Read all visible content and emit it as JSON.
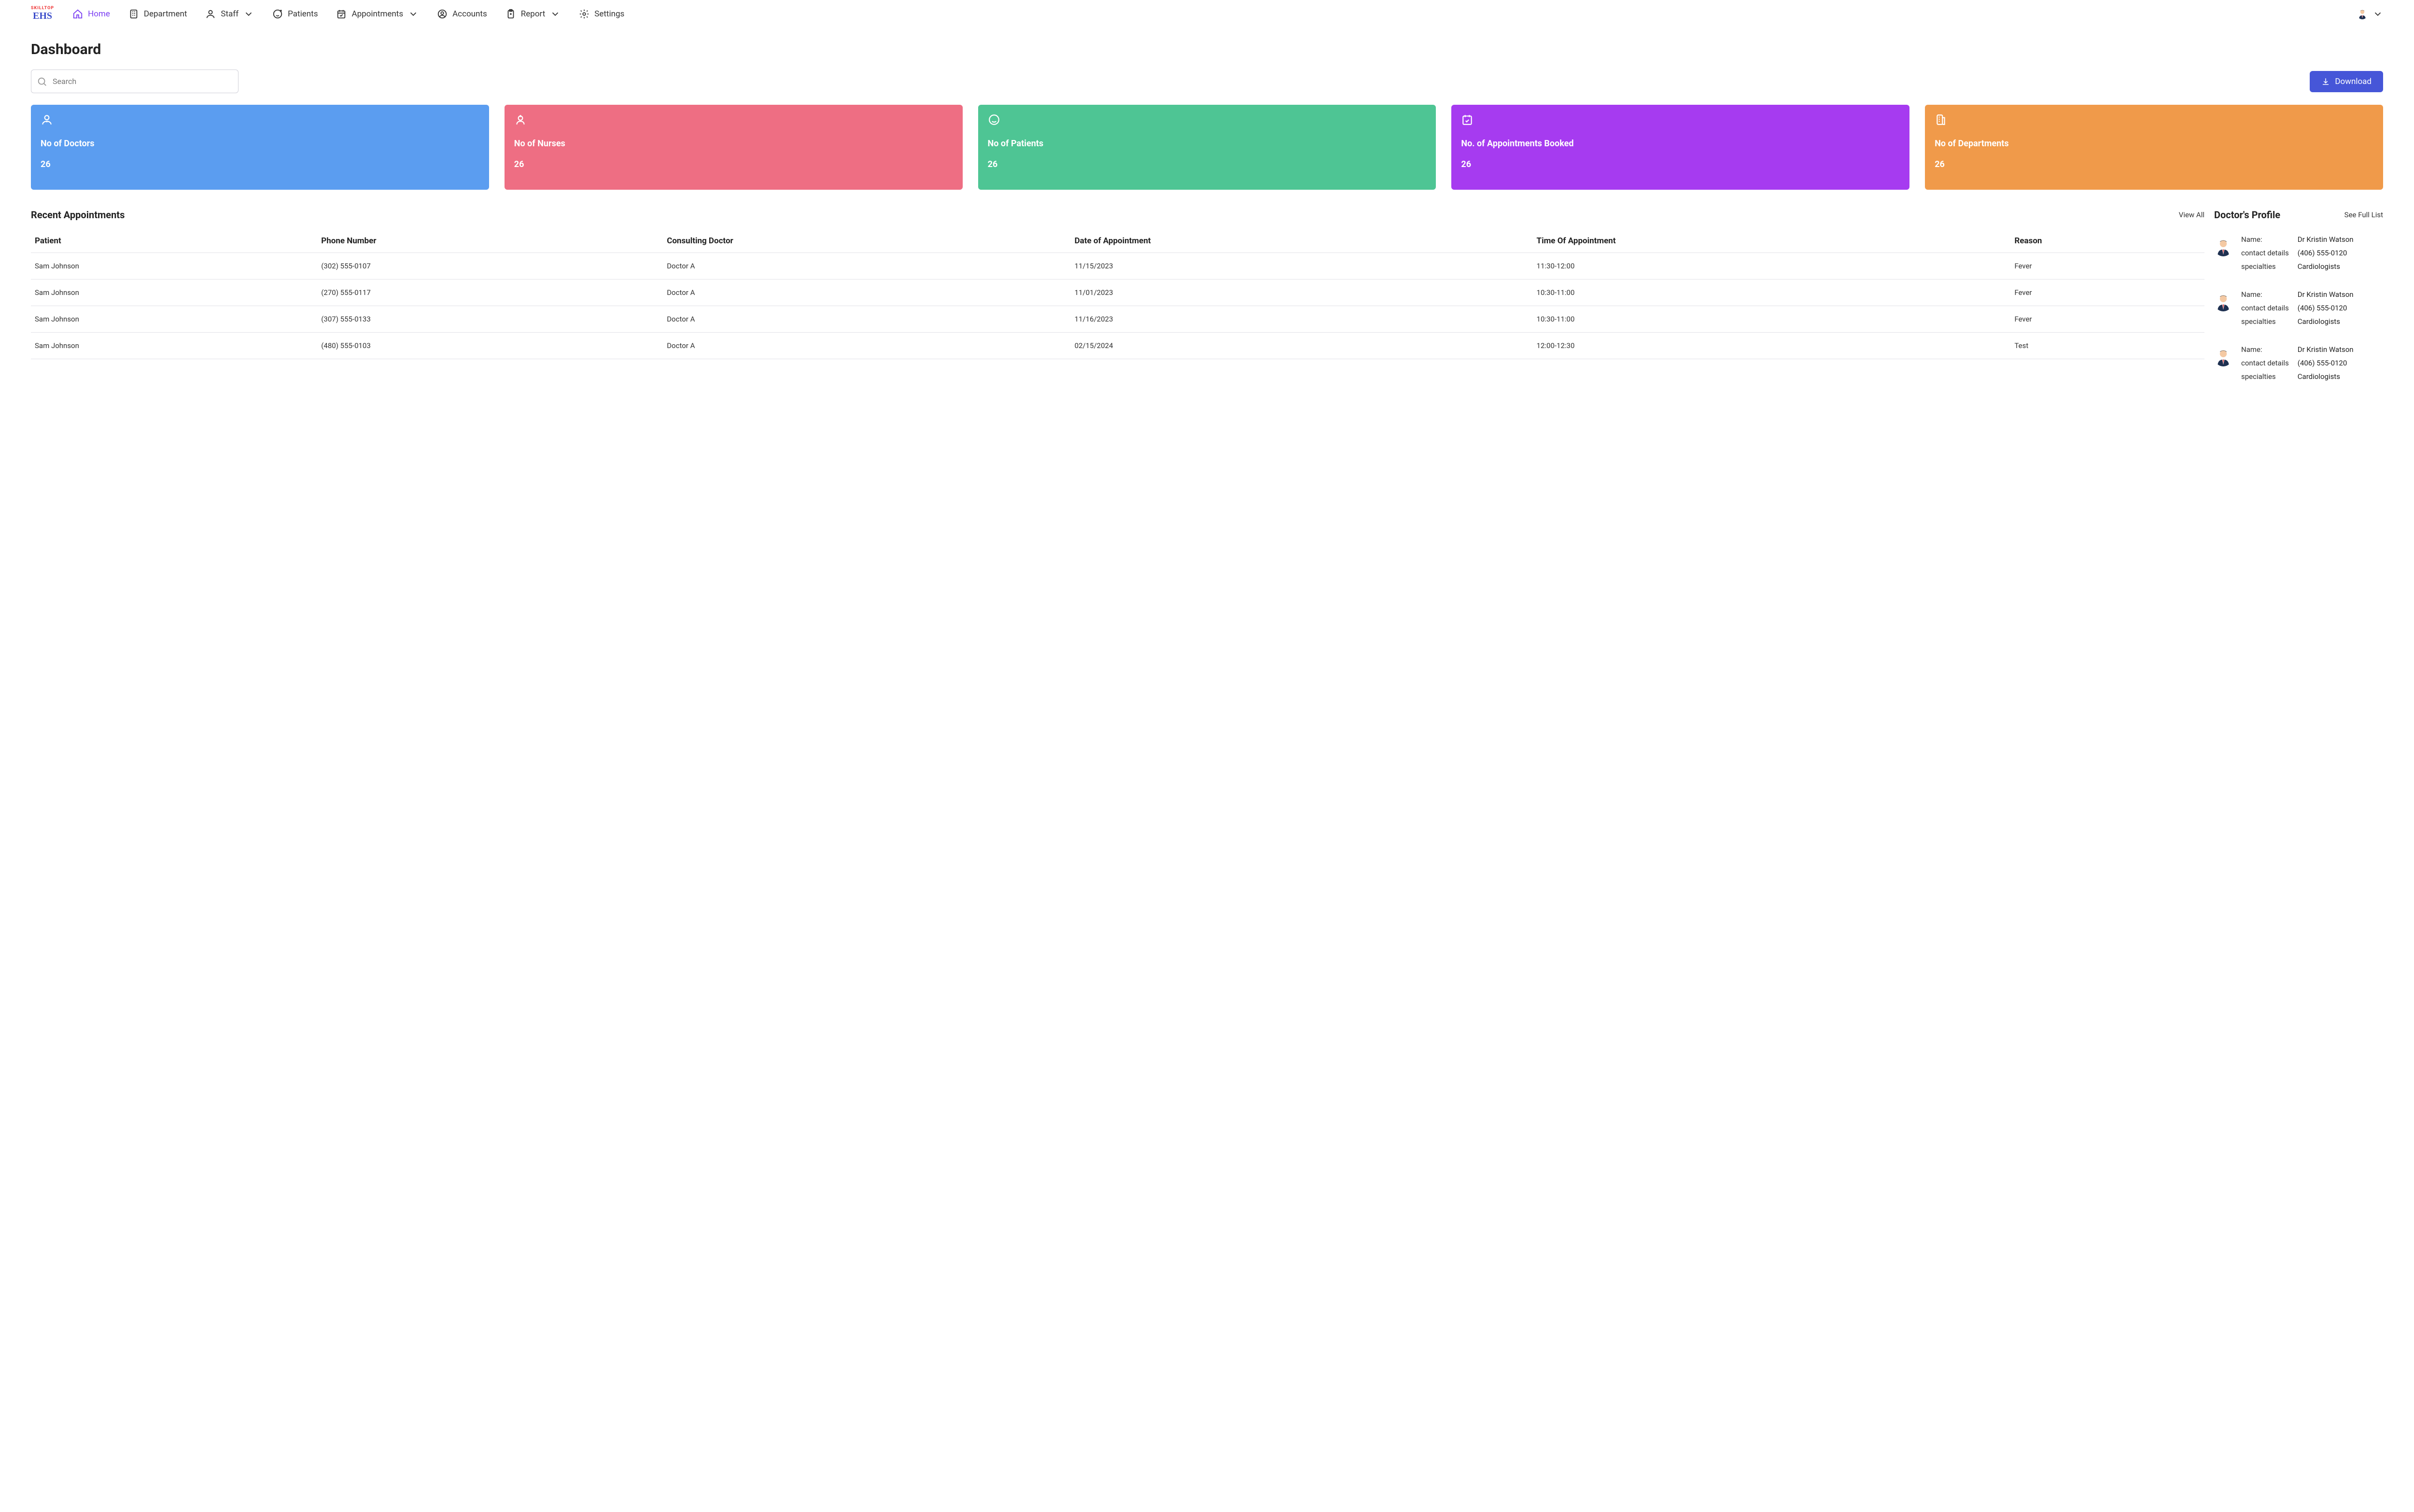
{
  "logo": {
    "top": "SKILLTOP",
    "main": "EHS"
  },
  "nav": {
    "home": "Home",
    "department": "Department",
    "staff": "Staff",
    "patients": "Patients",
    "appointments": "Appointments",
    "accounts": "Accounts",
    "report": "Report",
    "settings": "Settings"
  },
  "page_title": "Dashboard",
  "search": {
    "placeholder": "Search"
  },
  "download_label": "Download",
  "cards": {
    "doctors": {
      "label": "No of Doctors",
      "value": "26"
    },
    "nurses": {
      "label": "No of Nurses",
      "value": "26"
    },
    "patients": {
      "label": "No of Patients",
      "value": "26"
    },
    "appointments": {
      "label": "No. of  Appointments Booked",
      "value": "26"
    },
    "departments": {
      "label": "No of Departments",
      "value": "26"
    }
  },
  "recent": {
    "title": "Recent Appointments",
    "view_all": "View All",
    "columns": {
      "patient": "Patient",
      "phone": "Phone Number",
      "doctor": "Consulting Doctor",
      "date": "Date of Appointment",
      "time": "Time Of Appointment",
      "reason": "Reason"
    },
    "rows": [
      {
        "patient": "Sam Johnson",
        "phone": "(302) 555-0107",
        "doctor": "Doctor A",
        "date": "11/15/2023",
        "time": "11:30-12:00",
        "reason": "Fever"
      },
      {
        "patient": "Sam Johnson",
        "phone": "(270) 555-0117",
        "doctor": "Doctor A",
        "date": "11/01/2023",
        "time": "10:30-11:00",
        "reason": "Fever"
      },
      {
        "patient": "Sam Johnson",
        "phone": "(307) 555-0133",
        "doctor": "Doctor A",
        "date": "11/16/2023",
        "time": "10:30-11:00",
        "reason": "Fever"
      },
      {
        "patient": "Sam Johnson",
        "phone": "(480) 555-0103",
        "doctor": "Doctor A",
        "date": "02/15/2024",
        "time": "12:00-12:30",
        "reason": "Test"
      }
    ]
  },
  "profile": {
    "title": "Doctor's Profile",
    "see_full": "See Full List",
    "field_labels": {
      "name": "Name:",
      "contact": "contact details",
      "spec": "specialties"
    },
    "items": [
      {
        "name": "Dr Kristin Watson",
        "contact": "(406) 555-0120",
        "spec": "Cardiologists"
      },
      {
        "name": "Dr Kristin Watson",
        "contact": "(406) 555-0120",
        "spec": "Cardiologists"
      },
      {
        "name": "Dr Kristin Watson",
        "contact": "(406) 555-0120",
        "spec": "Cardiologists"
      }
    ]
  }
}
